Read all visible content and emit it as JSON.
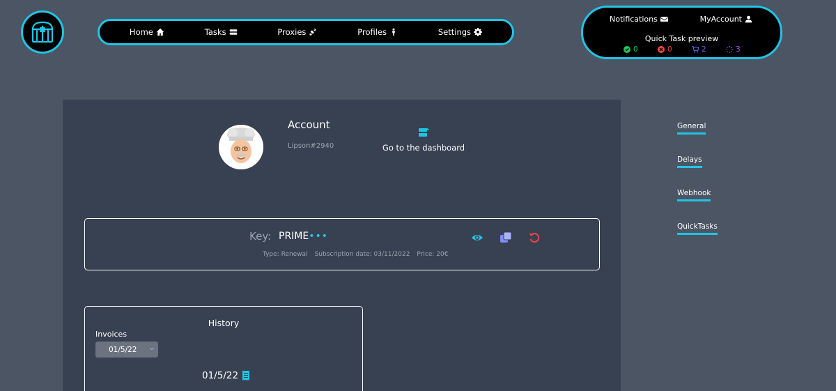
{
  "nav": {
    "items": [
      {
        "label": "Home",
        "icon": "home-icon"
      },
      {
        "label": "Tasks",
        "icon": "tasks-icon"
      },
      {
        "label": "Proxies",
        "icon": "satellite-icon"
      },
      {
        "label": "Profiles",
        "icon": "person-icon"
      },
      {
        "label": "Settings",
        "icon": "gear-icon"
      }
    ]
  },
  "quick": {
    "notifications": "Notifications",
    "account": "MyAccount",
    "title": "Quick Task preview",
    "stats": [
      {
        "value": "0",
        "color": "#22c55e",
        "icon": "check-circle-icon"
      },
      {
        "value": "0",
        "color": "#ef4444",
        "icon": "x-circle-icon"
      },
      {
        "value": "2",
        "color": "#6366f1",
        "icon": "cart-icon"
      },
      {
        "value": "3",
        "color": "#a855f7",
        "icon": "spinner-icon"
      }
    ]
  },
  "account": {
    "title": "Account",
    "username": "Lipson#2940",
    "dashboard_label": "Go to the dashboard"
  },
  "key": {
    "label": "Key:",
    "value": "PRIME",
    "masked": "•••",
    "type": "Type: Renewal",
    "subscription": "Subscription date: 03/11/2022",
    "price": "Price: 20€"
  },
  "history": {
    "title": "History",
    "invoices_label": "Invoices",
    "selected": "01/5/22",
    "date": "01/5/22"
  },
  "side": {
    "links": [
      "General",
      "Delays",
      "Webhook",
      "QuickTasks"
    ]
  },
  "colors": {
    "accent": "#22c4e6",
    "background": "#4b5563",
    "panel": "#374151"
  }
}
